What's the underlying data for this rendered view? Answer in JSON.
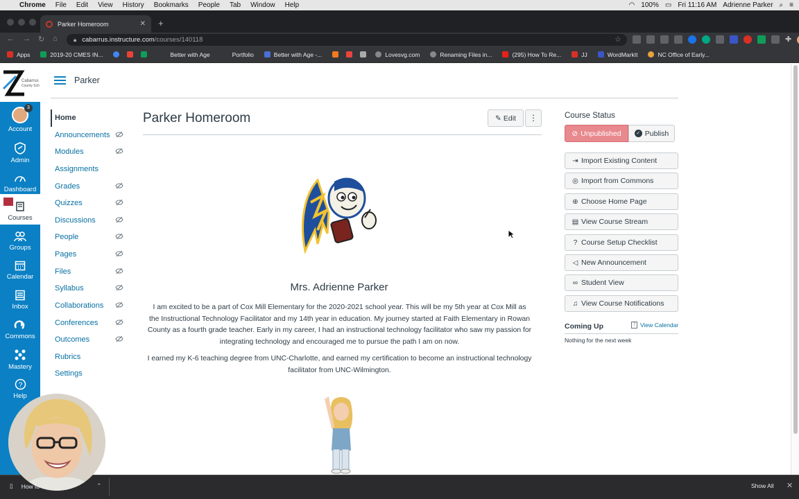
{
  "menubar": {
    "app": "Chrome",
    "items": [
      "File",
      "Edit",
      "View",
      "History",
      "Bookmarks",
      "People",
      "Tab",
      "Window",
      "Help"
    ],
    "battery": "100%",
    "clock": "Fri 11:16 AM",
    "user": "Adrienne Parker"
  },
  "browser": {
    "tab_title": "Parker Homeroom",
    "url_host": "cabarrus.instructure.com",
    "url_path": "/courses/140118",
    "bookmarks": [
      {
        "label": "Apps",
        "color": "#d93025"
      },
      {
        "label": "2019-20 CMES IN...",
        "color": "#0f9d58"
      },
      {
        "label": "",
        "color": "#4285f4"
      },
      {
        "label": "",
        "color": "#ea4335"
      },
      {
        "label": "",
        "color": "#0f9d58"
      },
      {
        "label": "Better with Age",
        "color": "#35363a"
      },
      {
        "label": "Portfolio",
        "color": "#35363a"
      },
      {
        "label": "Better with Age -...",
        "color": "#4a6fd6"
      },
      {
        "label": "",
        "color": "#f4791f"
      },
      {
        "label": "",
        "color": "#e8453c"
      },
      {
        "label": "",
        "color": "#aaaaaa"
      },
      {
        "label": "Lovesvg.com",
        "color": "#888888"
      },
      {
        "label": "Renaming Files in...",
        "color": "#888888"
      },
      {
        "label": "(295) How To Re...",
        "color": "#e62117"
      },
      {
        "label": "JJ",
        "color": "#d93025"
      },
      {
        "label": "WordMarkIt",
        "color": "#3a56c5"
      },
      {
        "label": "NC Office of Early...",
        "color": "#e8a33c"
      }
    ]
  },
  "global_nav": {
    "account": "Account",
    "account_badge": "3",
    "admin": "Admin",
    "dashboard": "Dashboard",
    "courses": "Courses",
    "groups": "Groups",
    "calendar": "Calendar",
    "inbox": "Inbox",
    "commons": "Commons",
    "mastery": "Mastery",
    "help": "Help",
    "logo_text": "Cabarrus County Schools"
  },
  "header": {
    "breadcrumb": "Parker"
  },
  "course_nav": {
    "items": [
      {
        "label": "Home",
        "hidden": false
      },
      {
        "label": "Announcements",
        "hidden": true
      },
      {
        "label": "Modules",
        "hidden": true
      },
      {
        "label": "Assignments",
        "hidden": false
      },
      {
        "label": "Grades",
        "hidden": true
      },
      {
        "label": "Quizzes",
        "hidden": true
      },
      {
        "label": "Discussions",
        "hidden": true
      },
      {
        "label": "People",
        "hidden": true
      },
      {
        "label": "Pages",
        "hidden": true
      },
      {
        "label": "Files",
        "hidden": true
      },
      {
        "label": "Syllabus",
        "hidden": true
      },
      {
        "label": "Collaborations",
        "hidden": true
      },
      {
        "label": "Conferences",
        "hidden": true
      },
      {
        "label": "Outcomes",
        "hidden": true
      },
      {
        "label": "Rubrics",
        "hidden": false
      },
      {
        "label": "Settings",
        "hidden": false
      }
    ]
  },
  "main": {
    "title": "Parker Homeroom",
    "edit_label": "Edit",
    "teacher_name": "Mrs. Adrienne Parker",
    "paragraph1": "I am excited to be a part of Cox Mill Elementary for the 2020-2021 school year. This will be my 5th year at Cox Mill as the Instructional Technology Facilitator and my 14th year in education. My journey started at Faith Elementary in Rowan County as a fourth grade teacher. Early in my career, I had an instructional technology facilitator who saw my passion for integrating technology and encouraged me to pursue the path I am on now.",
    "paragraph2": "I earned my K-6 teaching degree from UNC-Charlotte, and earned my certification to become an instructional technology facilitator from UNC-Wilmington."
  },
  "sidebar": {
    "status_label": "Course Status",
    "unpublished": "Unpublished",
    "publish": "Publish",
    "buttons": [
      {
        "label": "Import Existing Content",
        "icon": "import-icon"
      },
      {
        "label": "Import from Commons",
        "icon": "commons-icon"
      },
      {
        "label": "Choose Home Page",
        "icon": "target-icon"
      },
      {
        "label": "View Course Stream",
        "icon": "stream-icon"
      },
      {
        "label": "Course Setup Checklist",
        "icon": "question-icon"
      },
      {
        "label": "New Announcement",
        "icon": "megaphone-icon"
      },
      {
        "label": "Student View",
        "icon": "glasses-icon"
      },
      {
        "label": "View Course Notifications",
        "icon": "bell-icon"
      }
    ],
    "coming_up": "Coming Up",
    "view_calendar": "View Calendar",
    "nothing": "Nothing for the next week"
  },
  "downloads": {
    "file": "How to c...t...pdf",
    "show_all": "Show All"
  },
  "colors": {
    "nav_blue": "#0b80c4",
    "link_blue": "#0770a3",
    "unpublished_red": "#e8898e"
  }
}
